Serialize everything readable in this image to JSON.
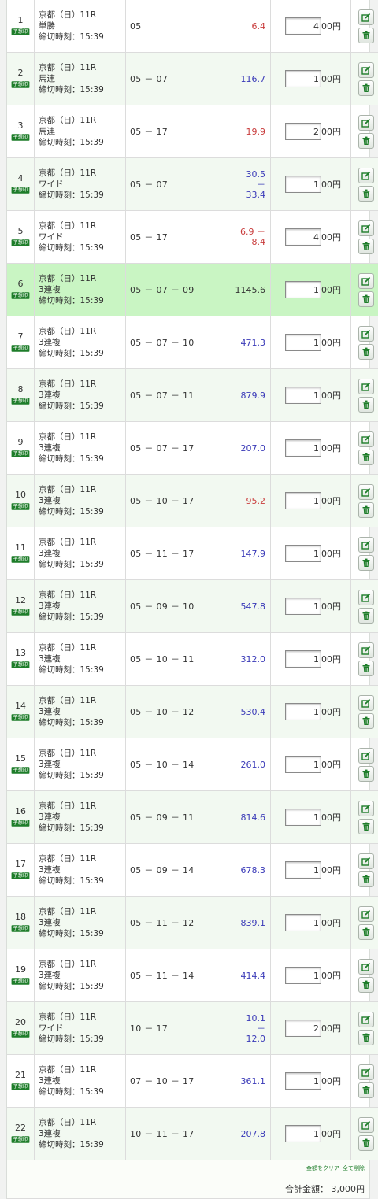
{
  "footer": {
    "clear_amounts": "金額をクリア",
    "delete_all": "全て削除",
    "total_label": "合計金額：",
    "total_value": "3,000円"
  },
  "yen_suffix": "00円",
  "badge_label": "予想印",
  "icons": {
    "edit": "edit-icon",
    "trash": "trash-icon"
  },
  "colors": {
    "accent": "#1e7d2a",
    "highlight_row": "#c9f5c3",
    "odds_red": "#c83a3a",
    "odds_blue": "#3a3ab8"
  },
  "bets": [
    {
      "no": "1",
      "race": "京都（日）11R",
      "type": "単勝",
      "deadline": "締切時刻：15:39",
      "pick": "05",
      "odds": [
        "6.4"
      ],
      "odds_color": "red",
      "amount": "4"
    },
    {
      "no": "2",
      "race": "京都（日）11R",
      "type": "馬連",
      "deadline": "締切時刻：15:39",
      "pick": "05 － 07",
      "odds": [
        "116.7"
      ],
      "odds_color": "blue",
      "amount": "1"
    },
    {
      "no": "3",
      "race": "京都（日）11R",
      "type": "馬連",
      "deadline": "締切時刻：15:39",
      "pick": "05 － 17",
      "odds": [
        "19.9"
      ],
      "odds_color": "red",
      "amount": "2"
    },
    {
      "no": "4",
      "race": "京都（日）11R",
      "type": "ワイド",
      "deadline": "締切時刻：15:39",
      "pick": "05 － 07",
      "odds": [
        "30.5",
        "－",
        "33.4"
      ],
      "odds_color": "blue",
      "amount": "1"
    },
    {
      "no": "5",
      "race": "京都（日）11R",
      "type": "ワイド",
      "deadline": "締切時刻：15:39",
      "pick": "05 － 17",
      "odds": [
        "6.9 －",
        "8.4"
      ],
      "odds_color": "red",
      "amount": "4"
    },
    {
      "no": "6",
      "race": "京都（日）11R",
      "type": "3連複",
      "deadline": "締切時刻：15:39",
      "pick": "05 － 07 － 09",
      "odds": [
        "1145.6"
      ],
      "odds_color": "plain",
      "amount": "1",
      "highlight": true
    },
    {
      "no": "7",
      "race": "京都（日）11R",
      "type": "3連複",
      "deadline": "締切時刻：15:39",
      "pick": "05 － 07 － 10",
      "odds": [
        "471.3"
      ],
      "odds_color": "blue",
      "amount": "1"
    },
    {
      "no": "8",
      "race": "京都（日）11R",
      "type": "3連複",
      "deadline": "締切時刻：15:39",
      "pick": "05 － 07 － 11",
      "odds": [
        "879.9"
      ],
      "odds_color": "blue",
      "amount": "1"
    },
    {
      "no": "9",
      "race": "京都（日）11R",
      "type": "3連複",
      "deadline": "締切時刻：15:39",
      "pick": "05 － 07 － 17",
      "odds": [
        "207.0"
      ],
      "odds_color": "blue",
      "amount": "1"
    },
    {
      "no": "10",
      "race": "京都（日）11R",
      "type": "3連複",
      "deadline": "締切時刻：15:39",
      "pick": "05 － 10 － 17",
      "odds": [
        "95.2"
      ],
      "odds_color": "red",
      "amount": "1"
    },
    {
      "no": "11",
      "race": "京都（日）11R",
      "type": "3連複",
      "deadline": "締切時刻：15:39",
      "pick": "05 － 11 － 17",
      "odds": [
        "147.9"
      ],
      "odds_color": "blue",
      "amount": "1"
    },
    {
      "no": "12",
      "race": "京都（日）11R",
      "type": "3連複",
      "deadline": "締切時刻：15:39",
      "pick": "05 － 09 － 10",
      "odds": [
        "547.8"
      ],
      "odds_color": "blue",
      "amount": "1"
    },
    {
      "no": "13",
      "race": "京都（日）11R",
      "type": "3連複",
      "deadline": "締切時刻：15:39",
      "pick": "05 － 10 － 11",
      "odds": [
        "312.0"
      ],
      "odds_color": "blue",
      "amount": "1"
    },
    {
      "no": "14",
      "race": "京都（日）11R",
      "type": "3連複",
      "deadline": "締切時刻：15:39",
      "pick": "05 － 10 － 12",
      "odds": [
        "530.4"
      ],
      "odds_color": "blue",
      "amount": "1"
    },
    {
      "no": "15",
      "race": "京都（日）11R",
      "type": "3連複",
      "deadline": "締切時刻：15:39",
      "pick": "05 － 10 － 14",
      "odds": [
        "261.0"
      ],
      "odds_color": "blue",
      "amount": "1"
    },
    {
      "no": "16",
      "race": "京都（日）11R",
      "type": "3連複",
      "deadline": "締切時刻：15:39",
      "pick": "05 － 09 － 11",
      "odds": [
        "814.6"
      ],
      "odds_color": "blue",
      "amount": "1"
    },
    {
      "no": "17",
      "race": "京都（日）11R",
      "type": "3連複",
      "deadline": "締切時刻：15:39",
      "pick": "05 － 09 － 14",
      "odds": [
        "678.3"
      ],
      "odds_color": "blue",
      "amount": "1"
    },
    {
      "no": "18",
      "race": "京都（日）11R",
      "type": "3連複",
      "deadline": "締切時刻：15:39",
      "pick": "05 － 11 － 12",
      "odds": [
        "839.1"
      ],
      "odds_color": "blue",
      "amount": "1"
    },
    {
      "no": "19",
      "race": "京都（日）11R",
      "type": "3連複",
      "deadline": "締切時刻：15:39",
      "pick": "05 － 11 － 14",
      "odds": [
        "414.4"
      ],
      "odds_color": "blue",
      "amount": "1"
    },
    {
      "no": "20",
      "race": "京都（日）11R",
      "type": "ワイド",
      "deadline": "締切時刻：15:39",
      "pick": "10 － 17",
      "odds": [
        "10.1",
        "－",
        "12.0"
      ],
      "odds_color": "blue",
      "amount": "2"
    },
    {
      "no": "21",
      "race": "京都（日）11R",
      "type": "3連複",
      "deadline": "締切時刻：15:39",
      "pick": "07 － 10 － 17",
      "odds": [
        "361.1"
      ],
      "odds_color": "blue",
      "amount": "1"
    },
    {
      "no": "22",
      "race": "京都（日）11R",
      "type": "3連複",
      "deadline": "締切時刻：15:39",
      "pick": "10 － 11 － 17",
      "odds": [
        "207.8"
      ],
      "odds_color": "blue",
      "amount": "1"
    }
  ]
}
